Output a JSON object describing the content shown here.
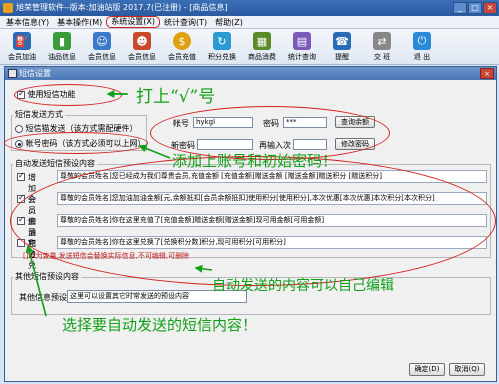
{
  "app": {
    "title": "旭荣管理软件--版本:加油站版 2017.7(已注册) - [商品信息]",
    "window_buttons": [
      "_",
      "□",
      "×"
    ]
  },
  "menu": [
    "基本信息(Y)",
    "基本操作(M)",
    "系统设置(X)",
    "统计查询(T)",
    "帮助(Z)"
  ],
  "toolbar": [
    {
      "label": "会员加油",
      "icon": "fuel-pump-icon",
      "color": "#2a6bb8"
    },
    {
      "label": "油品信息",
      "icon": "oil-barrel-icon",
      "color": "#3b9a3b"
    },
    {
      "label": "会员信息",
      "icon": "person-icon",
      "color": "#3a7ac8"
    },
    {
      "label": "会员信息",
      "icon": "people-icon",
      "color": "#c84a2a"
    },
    {
      "label": "会员充值",
      "icon": "coin-icon",
      "color": "#e0a010"
    },
    {
      "label": "积分兑换",
      "icon": "points-icon",
      "color": "#2a9ad0"
    },
    {
      "label": "商品消费",
      "icon": "cart-icon",
      "color": "#5a8a2a"
    },
    {
      "label": "统计查询",
      "icon": "chart-icon",
      "color": "#7a5ab8"
    },
    {
      "label": "提醒",
      "icon": "phone-icon",
      "color": "#2a6bb8"
    },
    {
      "label": "交 班",
      "icon": "handover-icon",
      "color": "#888888"
    },
    {
      "label": "退 出",
      "icon": "exit-icon",
      "color": "#2a8ad8"
    }
  ],
  "dialog": {
    "title": "短信设置",
    "close": "×",
    "enable_label": "使用短信功能",
    "mode_group": "短信发送方式",
    "mode_hw": "短信猫发送（该方式需配硬件）",
    "mode_account": "帐号密码（该方式必须可以上网）",
    "account_label": "帐号",
    "account_value": "hykgl",
    "password_label": "密码",
    "password_value": "***",
    "query_button": "查询余额",
    "new_password_label": "新密码",
    "confirm_label": "再输入次",
    "change_button": "修改密码",
    "auto_group": "自动发送短信预设内容",
    "rows": [
      {
        "label": "增加会员",
        "checked": true,
        "text": "尊敬的会员姓名]您已经成为我们尊贵会员,充值金额 [充值金额]赠送金额 [赠送金额]赠送积分 [赠送积分]"
      },
      {
        "label": "会员加油",
        "checked": true,
        "text": "尊敬的会员姓名]您加油加油金额[元,余额抵扣[会员余额抵扣]使用积分[使用积分],本次优惠[本次优惠]本次积分[本次积分]"
      },
      {
        "label": "会员充值",
        "checked": true,
        "text": "尊敬的会员姓名]你在这里充值了[充值金额]赠送金额[赠送金额]现可用金额[可用金额]"
      },
      {
        "label": "积分兑换",
        "checked": false,
        "text": "尊敬的会员姓名]你在这里兑换了[兑换积分数]积分,现可用积分[可用积分]"
      }
    ],
    "warning": "[]中为变量,发送短信会替换实际信息,不可编辑,可删除",
    "other_group": "其他短信预设内容",
    "other_label": "其他信息预设",
    "other_value": "这里可以设置其它时常发送的预设内容",
    "ok_button": "确定(D)",
    "cancel_button": "取消(Q)"
  },
  "annotations": {
    "check_hint": "打上“√”号",
    "account_hint": "添加上账号和初始密码！",
    "edit_hint": "自动发送的内容可以自己编辑",
    "select_hint": "选择要自动发送的短信内容！"
  },
  "colors": {
    "annotation_red": "#d42020",
    "annotation_green": "#12a019"
  }
}
